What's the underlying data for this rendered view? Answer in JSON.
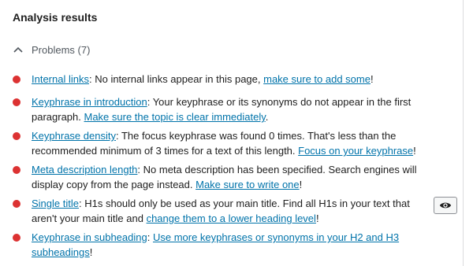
{
  "panel": {
    "title": "Analysis results",
    "problems_toggle": "Problems (7)",
    "status_color": "#dc3232"
  },
  "items": [
    {
      "link": "Internal links",
      "text": ": No internal links appear in this page, ",
      "cta": "make sure to add some",
      "end": "!"
    },
    {
      "link": "Keyphrase in introduction",
      "text": ": Your keyphrase or its synonyms do not appear in the first paragraph. ",
      "cta": "Make sure the topic is clear immediately",
      "end": "."
    },
    {
      "link": "Keyphrase density",
      "text": ": The focus keyphrase was found 0 times. That's less than the recommended minimum of 3 times for a text of this length. ",
      "cta": "Focus on your keyphrase",
      "end": "!"
    },
    {
      "link": "Meta description length",
      "text": ": No meta description has been specified. Search engines will display copy from the page instead. ",
      "cta": "Make sure to write one",
      "end": "!"
    },
    {
      "link": "Single title",
      "text": ": H1s should only be used as your main title. Find all H1s in your text that aren't your main title and ",
      "cta": "change them to a lower heading level",
      "end": "!"
    },
    {
      "link": "Keyphrase in subheading",
      "text": ": ",
      "cta": "Use more keyphrases or synonyms in your H2 and H3 subheadings",
      "end": "!"
    }
  ],
  "icons": {
    "toggle": "chevron-up-icon",
    "highlight": "eye-icon"
  }
}
